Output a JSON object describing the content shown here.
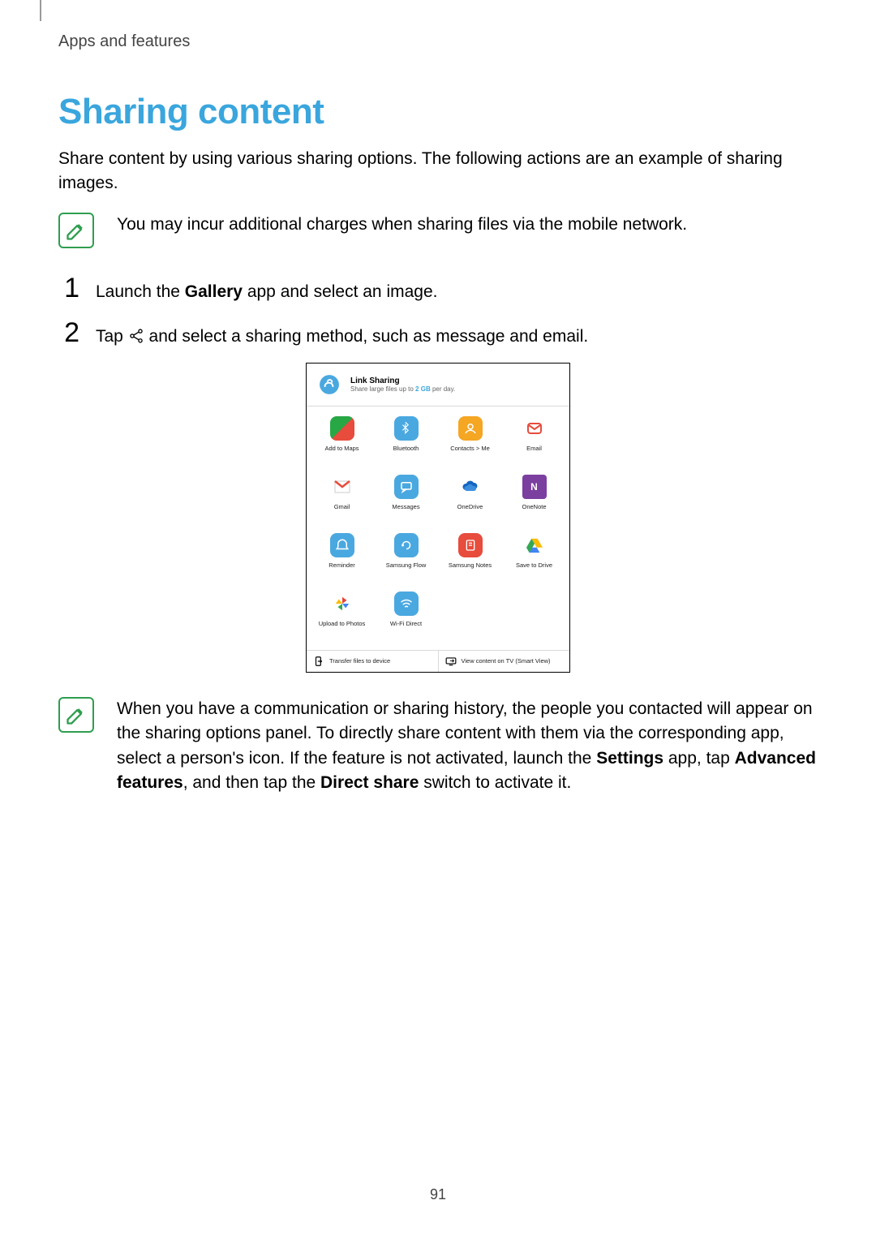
{
  "section": "Apps and features",
  "heading": "Sharing content",
  "intro": "Share content by using various sharing options. The following actions are an example of sharing images.",
  "note1": "You may incur additional charges when sharing files via the mobile network.",
  "steps": {
    "s1_num": "1",
    "s1_pre": "Launch the ",
    "s1_bold": "Gallery",
    "s1_post": " app and select an image.",
    "s2_num": "2",
    "s2_pre": "Tap ",
    "s2_post": " and select a sharing method, such as message and email."
  },
  "panel": {
    "link_sharing_title": "Link Sharing",
    "link_sharing_sub_pre": "Share large files up to ",
    "link_sharing_sub_bold": "2 GB",
    "link_sharing_sub_post": " per day.",
    "apps": [
      {
        "label": "Add to Maps"
      },
      {
        "label": "Bluetooth"
      },
      {
        "label": "Contacts > Me"
      },
      {
        "label": "Email"
      },
      {
        "label": "Gmail"
      },
      {
        "label": "Messages"
      },
      {
        "label": "OneDrive"
      },
      {
        "label": "OneNote"
      },
      {
        "label": "Reminder"
      },
      {
        "label": "Samsung Flow"
      },
      {
        "label": "Samsung Notes"
      },
      {
        "label": "Save to Drive"
      },
      {
        "label": "Upload to Photos"
      },
      {
        "label": "Wi-Fi Direct"
      }
    ],
    "bottom_left": "Transfer files to device",
    "bottom_right": "View content on TV (Smart View)"
  },
  "note2_pre": "When you have a communication or sharing history, the people you contacted will appear on the sharing options panel. To directly share content with them via the corresponding app, select a person's icon. If the feature is not activated, launch the ",
  "note2_b1": "Settings",
  "note2_mid1": " app, tap ",
  "note2_b2": "Advanced features",
  "note2_mid2": ", and then tap the ",
  "note2_b3": "Direct share",
  "note2_post": " switch to activate it.",
  "page_number": "91"
}
